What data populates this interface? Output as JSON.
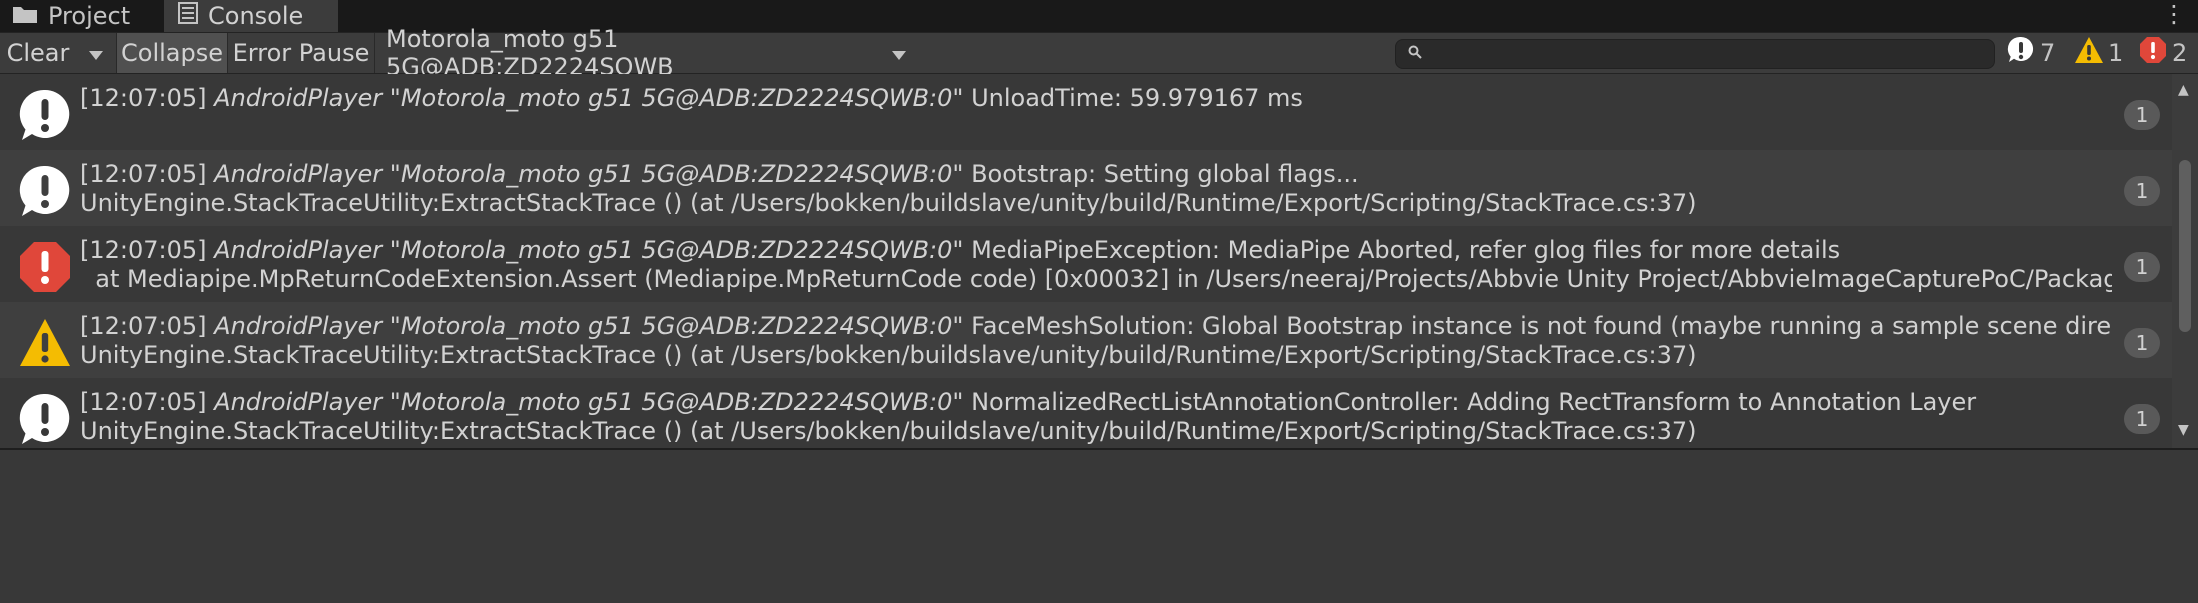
{
  "tabs": [
    {
      "label": "Project",
      "icon": "folder-icon"
    },
    {
      "label": "Console",
      "icon": "console-icon"
    }
  ],
  "toolbar": {
    "clear": "Clear",
    "collapse": "Collapse",
    "error_pause": "Error Pause",
    "device": "Motorola_moto g51 5G@ADB:ZD2224SQWB",
    "search_value": ""
  },
  "counters": {
    "info": "7",
    "warning": "1",
    "error": "2"
  },
  "colors": {
    "warning": "#f4bc02",
    "error": "#e0473a",
    "info": "#ffffff"
  },
  "entries": [
    {
      "type": "info",
      "time": "[12:07:05]",
      "source": "AndroidPlayer \"Motorola_moto g51 5G@ADB:ZD2224SQWB:0\"",
      "message": "UnloadTime: 59.979167 ms",
      "line2": "",
      "count": "1"
    },
    {
      "type": "info",
      "time": "[12:07:05]",
      "source": "AndroidPlayer \"Motorola_moto g51 5G@ADB:ZD2224SQWB:0\"",
      "message": "Bootstrap: Setting global flags...",
      "line2": "UnityEngine.StackTraceUtility:ExtractStackTrace () (at /Users/bokken/buildslave/unity/build/Runtime/Export/Scripting/StackTrace.cs:37)",
      "count": "1"
    },
    {
      "type": "error",
      "time": "[12:07:05]",
      "source": "AndroidPlayer \"Motorola_moto g51 5G@ADB:ZD2224SQWB:0\"",
      "message": "MediaPipeException: MediaPipe Aborted, refer glog files for more details",
      "line2": "  at Mediapipe.MpReturnCodeExtension.Assert (Mediapipe.MpReturnCode code) [0x00032] in /Users/neeraj/Projects/Abbvie Unity Project/AbbvieImageCapturePoC/Packages/package/Ru",
      "count": "1"
    },
    {
      "type": "warning",
      "time": "[12:07:05]",
      "source": "AndroidPlayer \"Motorola_moto g51 5G@ADB:ZD2224SQWB:0\"",
      "message": "FaceMeshSolution: Global Bootstrap instance is not found (maybe running a sample scene directly), so activating",
      "line2": "UnityEngine.StackTraceUtility:ExtractStackTrace () (at /Users/bokken/buildslave/unity/build/Runtime/Export/Scripting/StackTrace.cs:37)",
      "count": "1"
    },
    {
      "type": "info",
      "time": "[12:07:05]",
      "source": "AndroidPlayer \"Motorola_moto g51 5G@ADB:ZD2224SQWB:0\"",
      "message": "NormalizedRectListAnnotationController: Adding RectTransform to Annotation Layer",
      "line2": "UnityEngine.StackTraceUtility:ExtractStackTrace () (at /Users/bokken/buildslave/unity/build/Runtime/Export/Scripting/StackTrace.cs:37)",
      "count": "1"
    }
  ]
}
